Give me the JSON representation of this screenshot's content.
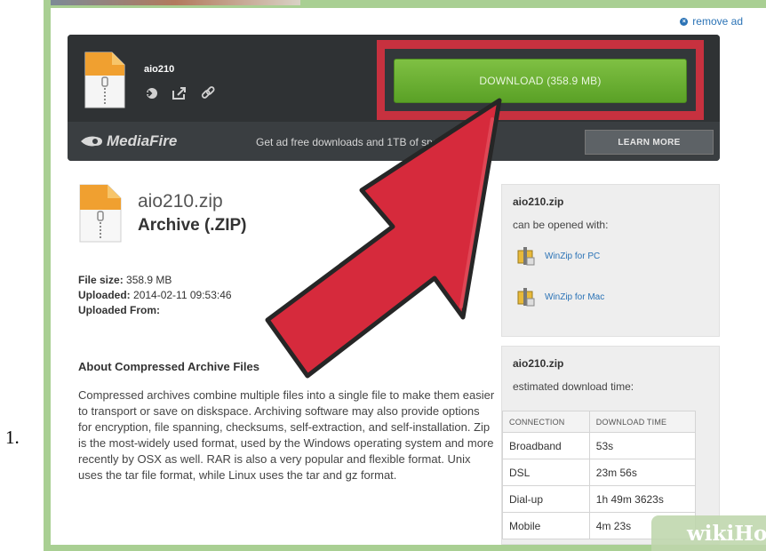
{
  "list_marker": "1.",
  "remove_ad": "remove ad",
  "download_panel": {
    "filename": "aio210",
    "download_button": "DOWNLOAD (358.9 MB)",
    "brand": "MediaFire",
    "promo": "Get ad free downloads and 1TB of space.",
    "learn_more": "LEARN MORE",
    "action_icons": [
      "save-to-account-icon",
      "share-icon",
      "link-icon"
    ]
  },
  "file": {
    "name": "aio210.zip",
    "type": "Archive (.ZIP)",
    "size_label": "File size:",
    "size_value": "358.9 MB",
    "uploaded_label": "Uploaded:",
    "uploaded_value": "2014-02-11 09:53:46",
    "uploaded_from_label": "Uploaded From:"
  },
  "about": {
    "title": "About Compressed Archive Files",
    "text": "Compressed archives combine multiple files into a single file to make them easier to transport or save on diskspace. Archiving software may also provide options for encryption, file spanning, checksums, self-extraction, and self-installation. Zip is the most-widely used format, used by the Windows operating system and more recently by OSX as well. RAR is also a very popular and flexible format. Unix uses the tar file format, while Linux uses the tar and gz format."
  },
  "opens_with": {
    "title": "aio210.zip",
    "subtitle": "can be opened with:",
    "apps": [
      "WinZip for PC",
      "WinZip for Mac"
    ]
  },
  "download_time": {
    "title": "aio210.zip",
    "subtitle": "estimated download time:",
    "headers": [
      "CONNECTION",
      "DOWNLOAD TIME"
    ],
    "rows": [
      [
        "Broadband",
        "53s"
      ],
      [
        "DSL",
        "23m 56s"
      ],
      [
        "Dial-up",
        "1h 49m 3623s"
      ],
      [
        "Mobile",
        "4m 23s"
      ]
    ]
  },
  "watermark": {
    "wiki": "wiki",
    "how": "How"
  },
  "colors": {
    "frame": "#a9cf93",
    "panel": "#33373a",
    "highlight": "#c7313f",
    "download_green": "#6cb235",
    "arrow": "#d62a3c",
    "link": "#2b73b6"
  }
}
